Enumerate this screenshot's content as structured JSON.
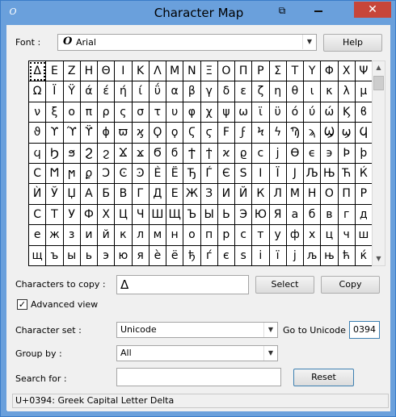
{
  "window": {
    "title": "Character Map",
    "close_glyph": "✕",
    "help_glyph": "⧉"
  },
  "font": {
    "label": "Font :",
    "value": "Arial",
    "font_icon": "O",
    "help_button": "Help"
  },
  "grid": {
    "selected_index": 0,
    "rows": [
      [
        "Δ",
        "Ε",
        "Ζ",
        "Η",
        "Θ",
        "Ι",
        "Κ",
        "Λ",
        "Μ",
        "Ν",
        "Ξ",
        "Ο",
        "Π",
        "Ρ",
        "Σ",
        "Τ",
        "Υ",
        "Φ",
        "Χ",
        "Ψ"
      ],
      [
        "Ω",
        "Ϊ",
        "Ϋ",
        "ά",
        "έ",
        "ή",
        "ί",
        "ΰ",
        "α",
        "β",
        "γ",
        "δ",
        "ε",
        "ζ",
        "η",
        "θ",
        "ι",
        "κ",
        "λ",
        "μ"
      ],
      [
        "ν",
        "ξ",
        "ο",
        "π",
        "ρ",
        "ς",
        "σ",
        "τ",
        "υ",
        "φ",
        "χ",
        "ψ",
        "ω",
        "ϊ",
        "ϋ",
        "ό",
        "ύ",
        "ώ",
        "Ϗ",
        "ϐ"
      ],
      [
        "ϑ",
        "ϒ",
        "ϓ",
        "ϔ",
        "ϕ",
        "ϖ",
        "ϗ",
        "Ϙ",
        "ϙ",
        "Ϛ",
        "ϛ",
        "Ϝ",
        "ϝ",
        "Ϟ",
        "ϟ",
        "Ϡ",
        "ϡ",
        "Ϣ",
        "ϣ",
        "Ϥ"
      ],
      [
        "ϥ",
        "Ϧ",
        "ϧ",
        "Ϩ",
        "ϩ",
        "Ϫ",
        "ϫ",
        "Ϭ",
        "ϭ",
        "Ϯ",
        "ϯ",
        "ϰ",
        "ϱ",
        "ϲ",
        "ϳ",
        "ϴ",
        "ϵ",
        "϶",
        "Ϸ",
        "ϸ"
      ],
      [
        "Ϲ",
        "Ϻ",
        "ϻ",
        "ϼ",
        "Ͻ",
        "Ͼ",
        "Ͽ",
        "Ѐ",
        "Ё",
        "Ђ",
        "Ѓ",
        "Є",
        "Ѕ",
        "І",
        "Ї",
        "Ј",
        "Љ",
        "Њ",
        "Ћ",
        "Ќ"
      ],
      [
        "Ѝ",
        "Ў",
        "Џ",
        "А",
        "Б",
        "В",
        "Г",
        "Д",
        "Е",
        "Ж",
        "З",
        "И",
        "Й",
        "К",
        "Л",
        "М",
        "Н",
        "О",
        "П",
        "Р"
      ],
      [
        "С",
        "Т",
        "У",
        "Ф",
        "Х",
        "Ц",
        "Ч",
        "Ш",
        "Щ",
        "Ъ",
        "Ы",
        "Ь",
        "Э",
        "Ю",
        "Я",
        "а",
        "б",
        "в",
        "г",
        "д"
      ],
      [
        "е",
        "ж",
        "з",
        "и",
        "й",
        "к",
        "л",
        "м",
        "н",
        "о",
        "п",
        "р",
        "с",
        "т",
        "у",
        "ф",
        "х",
        "ц",
        "ч",
        "ш"
      ],
      [
        "щ",
        "ъ",
        "ы",
        "ь",
        "э",
        "ю",
        "я",
        "ѐ",
        "ё",
        "ђ",
        "ѓ",
        "є",
        "ѕ",
        "і",
        "ї",
        "ј",
        "љ",
        "њ",
        "ћ",
        "ќ"
      ]
    ]
  },
  "copy": {
    "label": "Characters to copy :",
    "value": "Δ",
    "select_button": "Select",
    "copy_button": "Copy"
  },
  "advanced": {
    "label": "Advanced view",
    "checked_glyph": "✓"
  },
  "charset": {
    "label": "Character set :",
    "value": "Unicode"
  },
  "goto": {
    "label": "Go to Unicode :",
    "value": "0394"
  },
  "groupby": {
    "label": "Group by :",
    "value": "All"
  },
  "search": {
    "label": "Search for :",
    "value": "",
    "reset_button": "Reset"
  },
  "status": {
    "text": "U+0394: Greek Capital Letter Delta"
  },
  "icons": {
    "dropdown": "▼",
    "scroll_up": "▲",
    "scroll_down": "▼"
  }
}
